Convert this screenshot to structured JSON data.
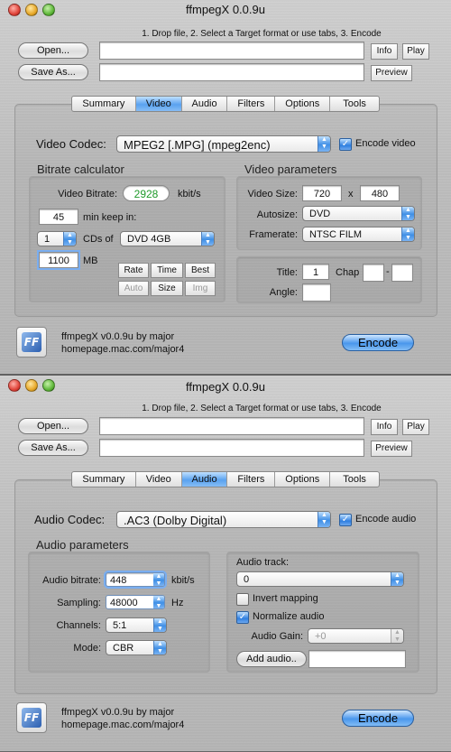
{
  "window1": {
    "title": "ffmpegX 0.0.9u",
    "hint": "1. Drop file, 2. Select a Target format or use tabs, 3. Encode",
    "open_label": "Open...",
    "save_as_label": "Save As...",
    "info_label": "Info",
    "play_label": "Play",
    "preview_label": "Preview",
    "tabs": [
      "Summary",
      "Video",
      "Audio",
      "Filters",
      "Options",
      "Tools"
    ],
    "active_tab": "Video",
    "video_codec_label": "Video Codec:",
    "video_codec_value": "MPEG2 [.MPG] (mpeg2enc)",
    "encode_video_label": "Encode video",
    "bitrate_calc": {
      "title": "Bitrate calculator",
      "video_bitrate_label": "Video Bitrate:",
      "video_bitrate_value": "2928",
      "bitrate_unit": "kbit/s",
      "minutes_value": "45",
      "minutes_label": "min keep in:",
      "cds_count": "1",
      "cds_label": "CDs of",
      "media_value": "DVD 4GB",
      "size_value": "1100",
      "size_unit": "MB",
      "rate_label": "Rate",
      "time_label": "Time",
      "best_label": "Best",
      "auto_label": "Auto",
      "size_label": "Size",
      "img_label": "Img"
    },
    "video_params": {
      "title": "Video parameters",
      "video_size_label": "Video Size:",
      "width": "720",
      "x_label": "x",
      "height": "480",
      "autosize_label": "Autosize:",
      "autosize_value": "DVD",
      "framerate_label": "Framerate:",
      "framerate_value": "NTSC FILM",
      "title_label": "Title:",
      "title_value": "1",
      "chap_label": "Chap",
      "chap_dash": "-",
      "angle_label": "Angle:"
    },
    "credit_line1": "ffmpegX v0.0.9u by major",
    "credit_line2": "homepage.mac.com/major4",
    "encode_label": "Encode"
  },
  "window2": {
    "title": "ffmpegX 0.0.9u",
    "hint": "1. Drop file, 2. Select a Target format or use tabs, 3. Encode",
    "open_label": "Open...",
    "save_as_label": "Save As...",
    "info_label": "Info",
    "play_label": "Play",
    "preview_label": "Preview",
    "tabs": [
      "Summary",
      "Video",
      "Audio",
      "Filters",
      "Options",
      "Tools"
    ],
    "active_tab": "Audio",
    "audio_codec_label": "Audio Codec:",
    "audio_codec_value": ".AC3 (Dolby Digital)",
    "encode_audio_label": "Encode audio",
    "audio_params": {
      "title": "Audio parameters",
      "bitrate_label": "Audio bitrate:",
      "bitrate_value": "448",
      "bitrate_unit": "kbit/s",
      "sampling_label": "Sampling:",
      "sampling_value": "48000",
      "sampling_unit": "Hz",
      "channels_label": "Channels:",
      "channels_value": "5:1",
      "mode_label": "Mode:",
      "mode_value": "CBR"
    },
    "audio_track": {
      "label": "Audio track:",
      "value": "0",
      "invert_label": "Invert mapping",
      "normalize_label": "Normalize audio",
      "gain_label": "Audio Gain:",
      "gain_value": "+0",
      "add_audio_label": "Add audio.."
    },
    "credit_line1": "ffmpegX v0.0.9u by major",
    "credit_line2": "homepage.mac.com/major4",
    "encode_label": "Encode"
  }
}
